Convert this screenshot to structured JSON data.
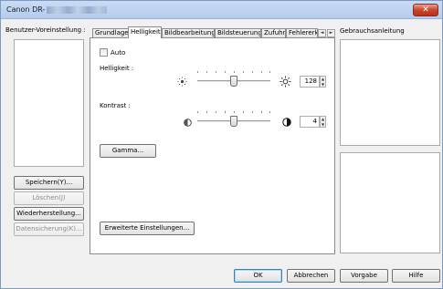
{
  "window": {
    "title": "Canon DR-",
    "close_glyph": "✕"
  },
  "presets": {
    "label": "Benutzer-Voreinstellung :",
    "buttons": {
      "save": "Speichern(Y)...",
      "delete": "Löschen(J)",
      "restore": "Wiederherstellung...",
      "backup": "Datensicherung(K)..."
    }
  },
  "tabs": {
    "items": [
      "Grundlage",
      "Helligkeit",
      "Bildbearbeitung",
      "Bildsteuerung",
      "Zufuhr",
      "Fehlererk"
    ],
    "active": "Helligkeit",
    "scroll_left": "◄",
    "scroll_right": "►"
  },
  "brightness": {
    "auto_label": "Auto",
    "label": "Helligkeit :",
    "value": "128",
    "level_fraction": 0.5,
    "low_icon": "sun-dim-icon",
    "high_icon": "sun-bright-icon"
  },
  "contrast": {
    "label": "Kontrast :",
    "value": "4",
    "level_fraction": 0.5,
    "low_icon": "contrast-low-icon",
    "high_icon": "contrast-high-icon"
  },
  "buttons": {
    "gamma": "Gamma...",
    "advanced": "Erweiterte Einstellungen...",
    "ok": "OK",
    "cancel": "Abbrechen",
    "default": "Vorgabe",
    "help": "Hilfe"
  },
  "help_panel": {
    "label": "Gebrauchsanleitung"
  }
}
